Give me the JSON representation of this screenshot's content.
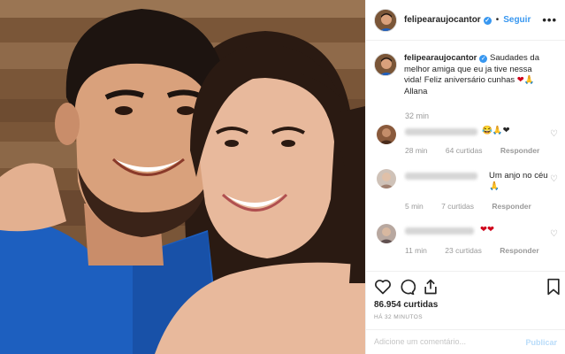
{
  "post": {
    "username": "felipearaujocantor",
    "follow_label": "Seguir",
    "header_separator": "•",
    "more_label": "•••"
  },
  "caption": {
    "username": "felipearaujocantor",
    "text": "Saudades da melhor amiga que eu ja tive nessa vida! Feliz aniversário cunhas",
    "emoji": "❤🙏",
    "signature": "Allana",
    "time": "32 min"
  },
  "comments": [
    {
      "text": "😂🙏❤",
      "time": "28 min",
      "likes": "64 curtidas",
      "reply": "Responder"
    },
    {
      "text": "Um anjo no céu 🙏",
      "time": "5 min",
      "likes": "7 curtidas",
      "reply": "Responder"
    },
    {
      "text": "❤❤",
      "time": "11 min",
      "likes": "23 curtidas",
      "reply": "Responder"
    }
  ],
  "stats": {
    "likes": "86.954 curtidas",
    "posted_ago": "HÁ 32 MINUTOS"
  },
  "composer": {
    "placeholder": "Adicione um comentário...",
    "publish_label": "Publicar"
  },
  "icons": {
    "like": "heart-outline-icon",
    "comment": "speech-bubble-icon",
    "share": "share-icon",
    "save": "bookmark-icon"
  },
  "colors": {
    "link_blue": "#3897f0",
    "verified_blue": "#3897f0",
    "muted_text": "#999999"
  }
}
